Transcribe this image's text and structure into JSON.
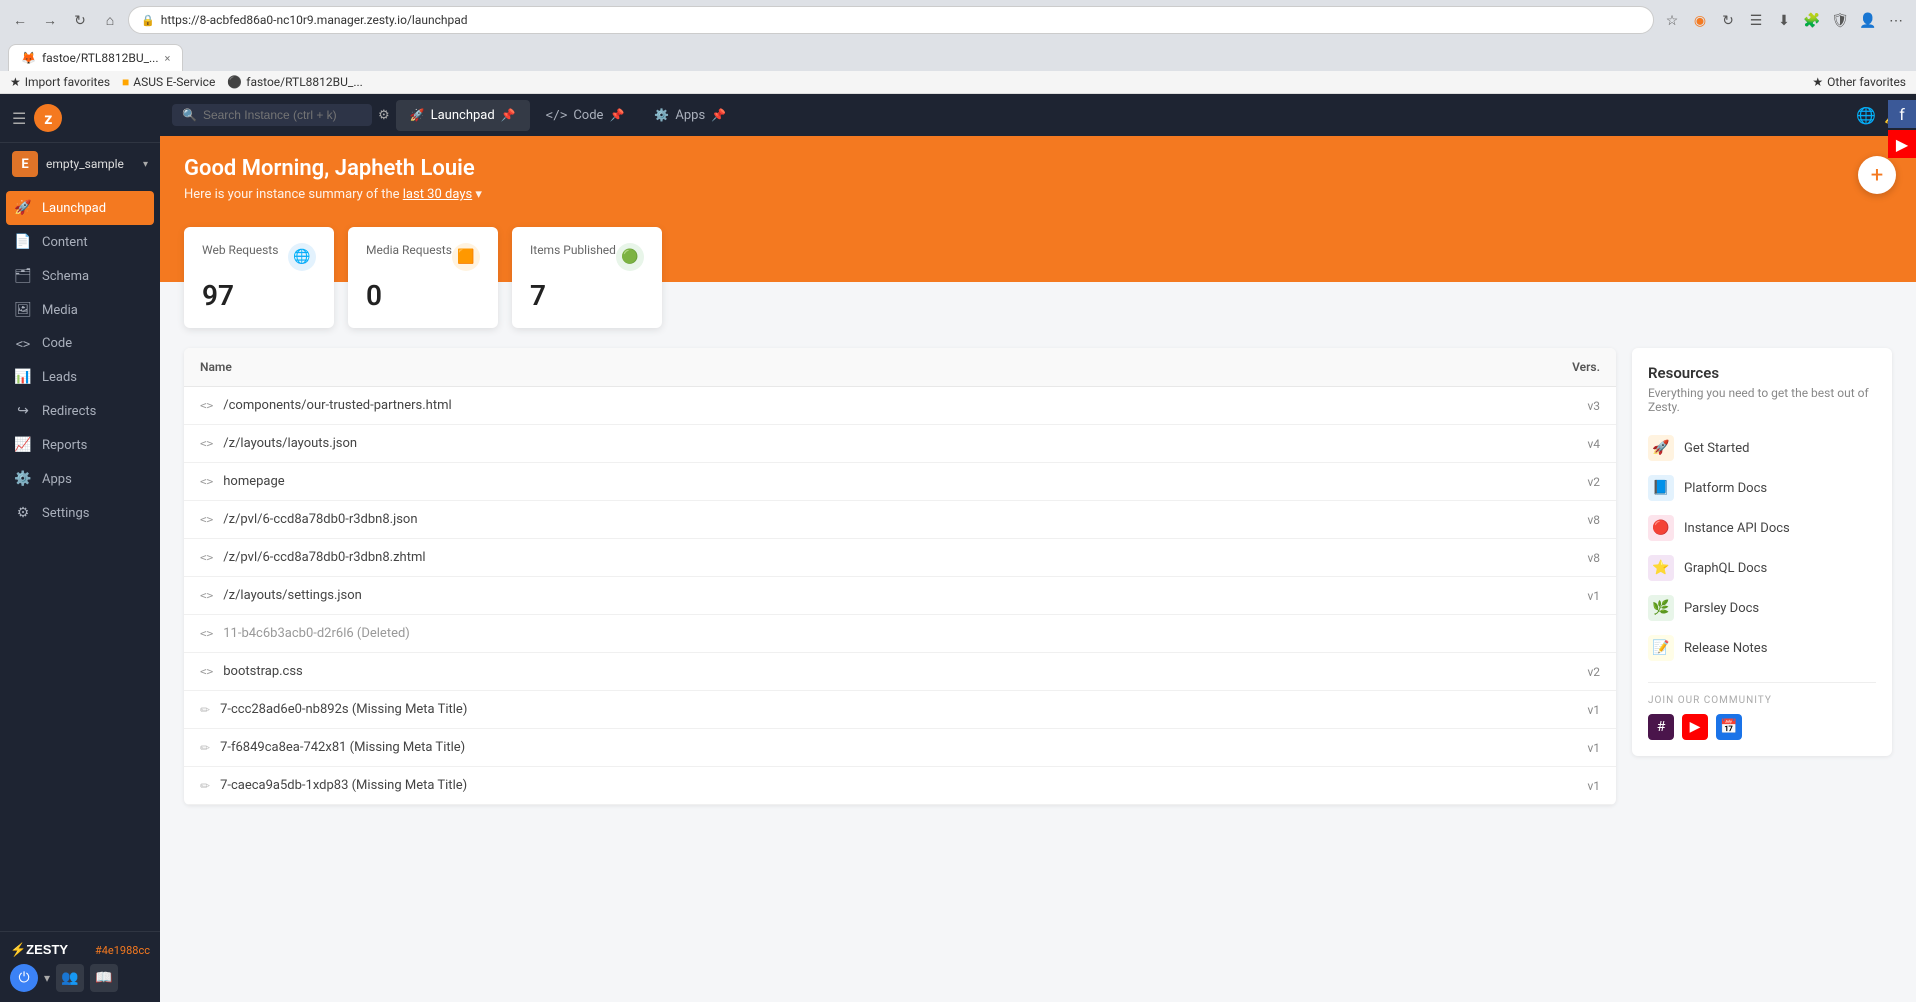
{
  "browser": {
    "url": "https://8-acbfed86a0-nc10r9.manager.zesty.io/launchpad",
    "tab_title": "fastoe/RTL8812BU_...",
    "bookmarks": [
      {
        "label": "Import favorites"
      },
      {
        "label": "ASUS E-Service"
      },
      {
        "label": "fastoe/RTL8812BU_..."
      },
      {
        "label": "Other favorites"
      }
    ]
  },
  "topnav": {
    "search_placeholder": "Search Instance (ctrl + k)",
    "tabs": [
      {
        "label": "Launchpad",
        "icon": "🚀",
        "active": true
      },
      {
        "label": "Code",
        "icon": "</>"
      },
      {
        "label": "Apps",
        "icon": "⚙️"
      }
    ],
    "pin_label": "📌"
  },
  "sidebar": {
    "toggle_icon": "☰",
    "instance_name": "empty_sample",
    "instance_initial": "E",
    "nav_items": [
      {
        "label": "Launchpad",
        "icon": "🚀",
        "active": true
      },
      {
        "label": "Content",
        "icon": "📄",
        "active": false
      },
      {
        "label": "Schema",
        "icon": "🗂",
        "active": false
      },
      {
        "label": "Media",
        "icon": "🖼",
        "active": false
      },
      {
        "label": "Code",
        "icon": "<>",
        "active": false
      },
      {
        "label": "Leads",
        "icon": "📊",
        "active": false
      },
      {
        "label": "Redirects",
        "icon": "↪",
        "active": false
      },
      {
        "label": "Reports",
        "icon": "📈",
        "active": false
      },
      {
        "label": "Apps",
        "icon": "⚙️",
        "active": false
      },
      {
        "label": "Settings",
        "icon": "⚙",
        "active": false
      }
    ],
    "wordmark": "ZESTY",
    "instance_hash": "#4e1988cc"
  },
  "header": {
    "greeting": "Good Morning, Japheth Louie",
    "subtitle_start": "Here is your instance summary of the",
    "time_range": "last 30 days",
    "add_icon": "+"
  },
  "stats": [
    {
      "label": "Web Requests",
      "value": "97",
      "icon": "🌐",
      "icon_type": "blue"
    },
    {
      "label": "Media Requests",
      "value": "0",
      "icon": "🟧",
      "icon_type": "orange"
    },
    {
      "label": "Items Published",
      "value": "7",
      "icon": "🟢",
      "icon_type": "green"
    }
  ],
  "table": {
    "col_name": "Name",
    "col_vers": "Vers.",
    "rows": [
      {
        "icon": "<>",
        "name": "/components/our-trusted-partners.html",
        "vers": "v3",
        "type": "code",
        "deleted": false
      },
      {
        "icon": "<>",
        "name": "/z/layouts/layouts.json",
        "vers": "v4",
        "type": "code",
        "deleted": false
      },
      {
        "icon": "<>",
        "name": "homepage",
        "vers": "v2",
        "type": "code",
        "deleted": false
      },
      {
        "icon": "<>",
        "name": "/z/pvl/6-ccd8a78db0-r3dbn8.json",
        "vers": "v8",
        "type": "code",
        "deleted": false
      },
      {
        "icon": "<>",
        "name": "/z/pvl/6-ccd8a78db0-r3dbn8.zhtml",
        "vers": "v8",
        "type": "code",
        "deleted": false
      },
      {
        "icon": "<>",
        "name": "/z/layouts/settings.json",
        "vers": "v1",
        "type": "code",
        "deleted": false
      },
      {
        "icon": "<>",
        "name": "11-b4c6b3acb0-d2r6l6 (Deleted)",
        "vers": "",
        "type": "code",
        "deleted": true
      },
      {
        "icon": "<>",
        "name": "bootstrap.css",
        "vers": "v2",
        "type": "code",
        "deleted": false
      },
      {
        "icon": "✏",
        "name": "7-ccc28ad6e0-nb892s (Missing Meta Title)",
        "vers": "v1",
        "type": "page",
        "deleted": false
      },
      {
        "icon": "✏",
        "name": "7-f6849ca8ea-742x81 (Missing Meta Title)",
        "vers": "v1",
        "type": "page",
        "deleted": false
      },
      {
        "icon": "✏",
        "name": "7-caeca9a5db-1xdp83 (Missing Meta Title)",
        "vers": "v1",
        "type": "page",
        "deleted": false
      }
    ]
  },
  "resources": {
    "title": "Resources",
    "subtitle": "Everything you need to get the best out of Zesty.",
    "items": [
      {
        "label": "Get Started",
        "icon": "🚀",
        "icon_type": "orange"
      },
      {
        "label": "Platform Docs",
        "icon": "📘",
        "icon_type": "blue"
      },
      {
        "label": "Instance API Docs",
        "icon": "🔴",
        "icon_type": "red"
      },
      {
        "label": "GraphQL Docs",
        "icon": "⭐",
        "icon_type": "purple"
      },
      {
        "label": "Parsley Docs",
        "icon": "🌿",
        "icon_type": "green"
      },
      {
        "label": "Release Notes",
        "icon": "📝",
        "icon_type": "yellow"
      }
    ],
    "community_label": "JOIN OUR COMMUNITY",
    "community_icons": [
      {
        "label": "Slack",
        "icon": "#"
      },
      {
        "label": "YouTube",
        "icon": "▶"
      },
      {
        "label": "Calendar",
        "icon": "📅"
      }
    ]
  },
  "bottom_bar": {
    "power_label": "⏻",
    "env_label": "▾",
    "icons": [
      "👥",
      "📖"
    ]
  }
}
